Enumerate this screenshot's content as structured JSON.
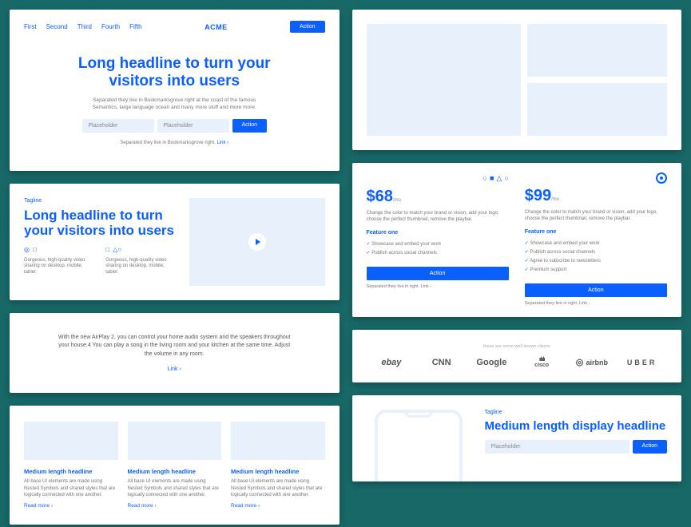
{
  "card1": {
    "nav": [
      "First",
      "Second",
      "Third",
      "Fourth",
      "Fifth"
    ],
    "logo": "ACME",
    "action": "Action",
    "headline": "Long headline to turn your visitors into users",
    "sub": "Separated they live in Bookmarksgrove right at the coast of the famous Semantics, large language ocean and many more stuff and more more.",
    "placeholder": "Placeholder",
    "cta": "Action",
    "foot": "Separated they live in Bookmarksgrove right.",
    "link": "Link ›"
  },
  "card2": {
    "tagline": "Tagline",
    "headline": "Long headline to turn your visitors into users",
    "feat": "Gorgeous, high-quality video sharing on desktop, mobile, tablet"
  },
  "card3": {
    "para": "With the new AirPlay 2, you can control your home audio system and the speakers throughout your house.4 You can play a song in the living room and your kitchen at the same time. Adjust the volume in any room.",
    "link": "Link ›"
  },
  "card4": {
    "heading": "Medium length headline",
    "desc": "All base UI elements are made using Nested Symbols and shared styles that are logically connected with one another.",
    "read": "Read more ›"
  },
  "pricing": {
    "p1": {
      "price": "$68",
      "per": "/mo"
    },
    "p2": {
      "price": "$99",
      "per": "/mo"
    },
    "desc": "Change the color to match your brand or vision, add your logo, choose the perfect thumbnail, remove the playbar.",
    "fone": "Feature one",
    "f": [
      "Showcase and embed your work",
      "Publish across social channels",
      "Agree to subscribe to newsletters",
      "Premium support"
    ],
    "btn": "Action",
    "link": "Separated they live in right.  Link ›"
  },
  "logos": {
    "head": "these are some well known clients",
    "items": [
      "ebay",
      "CNN",
      "Google",
      "cisco",
      "airbnb",
      "UBER"
    ]
  },
  "card8": {
    "tagline": "Tagline",
    "headline": "Medium length display headline",
    "placeholder": "Placeholder",
    "btn": "Action"
  }
}
